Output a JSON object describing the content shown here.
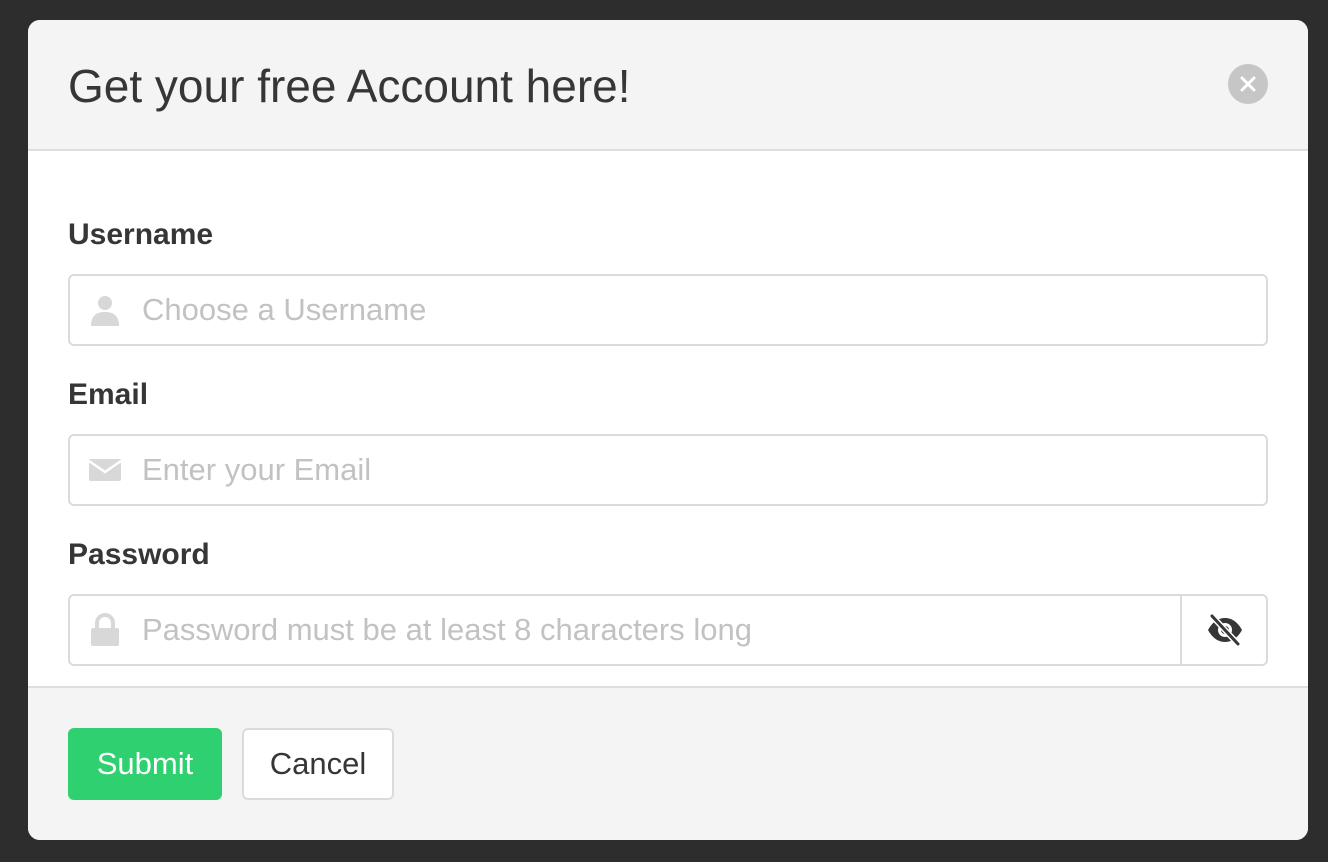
{
  "modal": {
    "title": "Get your free Account here!",
    "close_icon": "close-circle-icon"
  },
  "form": {
    "username": {
      "label": "Username",
      "placeholder": "Choose a Username",
      "value": "",
      "icon": "user-icon"
    },
    "email": {
      "label": "Email",
      "placeholder": "Enter your Email",
      "value": "",
      "icon": "envelope-icon"
    },
    "password": {
      "label": "Password",
      "placeholder": "Password must be at least 8 characters long",
      "value": "",
      "icon": "lock-icon",
      "toggle_icon": "eye-slash-icon"
    }
  },
  "footer": {
    "submit_label": "Submit",
    "cancel_label": "Cancel"
  },
  "colors": {
    "backdrop": "#2d2d2d",
    "header_bg": "#f4f4f4",
    "primary": "#2fd06f",
    "text": "#363636",
    "placeholder": "#c2c2c2",
    "border": "#dbdbdb",
    "icon_muted": "#d8d8d8"
  }
}
